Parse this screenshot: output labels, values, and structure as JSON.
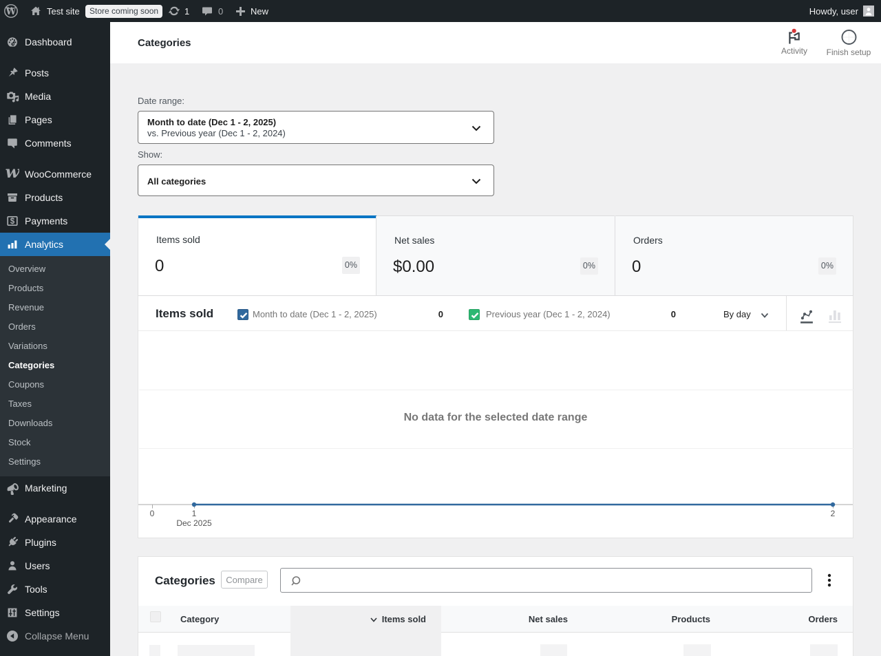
{
  "admin_bar": {
    "site_name": "Test site",
    "badge": "Store coming soon",
    "updates_count": "1",
    "comments_count": "0",
    "new_label": "New",
    "howdy": "Howdy, user"
  },
  "sidebar": {
    "items": [
      {
        "label": "Dashboard"
      },
      {
        "label": "Posts"
      },
      {
        "label": "Media"
      },
      {
        "label": "Pages"
      },
      {
        "label": "Comments"
      },
      {
        "label": "WooCommerce"
      },
      {
        "label": "Products"
      },
      {
        "label": "Payments"
      },
      {
        "label": "Analytics"
      },
      {
        "label": "Marketing"
      },
      {
        "label": "Appearance"
      },
      {
        "label": "Plugins"
      },
      {
        "label": "Users"
      },
      {
        "label": "Tools"
      },
      {
        "label": "Settings"
      }
    ],
    "active_item": "Analytics",
    "analytics_submenu": [
      "Overview",
      "Products",
      "Revenue",
      "Orders",
      "Variations",
      "Categories",
      "Coupons",
      "Taxes",
      "Downloads",
      "Stock",
      "Settings"
    ],
    "active_submenu": "Categories",
    "collapse_label": "Collapse Menu"
  },
  "header": {
    "title": "Categories",
    "activity_label": "Activity",
    "finish_setup_label": "Finish setup"
  },
  "filters": {
    "date_range_label": "Date range:",
    "date_range_primary": "Month to date (Dec 1 - 2, 2025)",
    "date_range_secondary": "vs. Previous year (Dec 1 - 2, 2024)",
    "show_label": "Show:",
    "show_value": "All categories"
  },
  "summary_tiles": [
    {
      "label": "Items sold",
      "value": "0",
      "delta": "0%"
    },
    {
      "label": "Net sales",
      "value": "$0.00",
      "delta": "0%"
    },
    {
      "label": "Orders",
      "value": "0",
      "delta": "0%"
    }
  ],
  "chart": {
    "title": "Items sold",
    "legend": [
      {
        "label": "Month to date (Dec 1 - 2, 2025)",
        "value": "0",
        "color": "#31699e"
      },
      {
        "label": "Previous year (Dec 1 - 2, 2024)",
        "value": "0",
        "color": "#2eb873"
      }
    ],
    "interval_label": "By day",
    "empty_message": "No data for the selected date range",
    "x_tick_0": "0",
    "x_tick_1": "1",
    "x_tick_2": "2",
    "x_axis_sublabel": "Dec 2025"
  },
  "chart_data": {
    "type": "line",
    "title": "Items sold",
    "x": [
      1,
      2
    ],
    "x_axis_ticks": [
      0,
      1,
      2
    ],
    "x_axis_sublabel": "Dec 2025",
    "series": [
      {
        "name": "Month to date (Dec 1 - 2, 2025)",
        "values": [
          0,
          0
        ],
        "color": "#31699e"
      },
      {
        "name": "Previous year (Dec 1 - 2, 2024)",
        "values": [
          0,
          0
        ],
        "color": "#2eb873"
      }
    ],
    "empty_message": "No data for the selected date range",
    "legend_totals": [
      0,
      0
    ],
    "grid": true,
    "legend_position": "top"
  },
  "table": {
    "title": "Categories",
    "compare_label": "Compare",
    "search_placeholder": "",
    "columns": [
      "Category",
      "Items sold",
      "Net sales",
      "Products",
      "Orders"
    ],
    "sorted_column": "Items sold",
    "sort_direction": "desc",
    "state": "loading"
  },
  "colors": {
    "admin_bar_bg": "#1d2327",
    "menu_active_bg": "#2271b1",
    "content_bg": "#f0f0f1",
    "tile_selected_border": "#0675c4",
    "chart_primary": "#31699e",
    "chart_secondary": "#2eb873",
    "notification_red": "#d63638"
  }
}
